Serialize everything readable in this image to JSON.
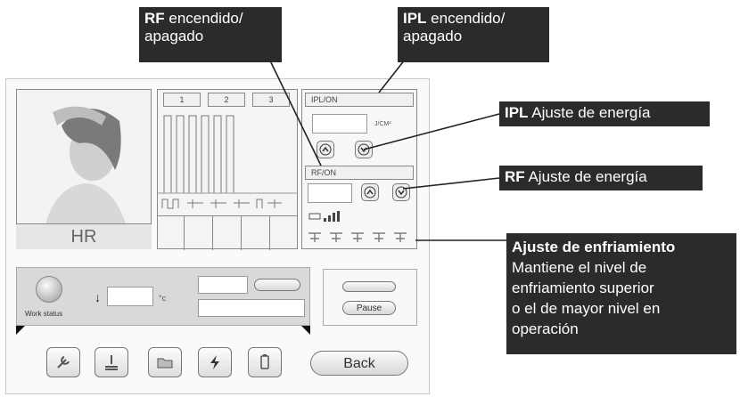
{
  "device": {
    "mode_label": "HR",
    "pulse_tabs": [
      "1",
      "2",
      "3"
    ],
    "ipl_header": "IPL/ON",
    "ipl_unit": "J/CM²",
    "rf_header": "RF/ON",
    "work_status_label": "Work status",
    "temp_unit": "°c",
    "pause_label": "Pause",
    "back_label": "Back"
  },
  "callouts": {
    "rf_onoff_bold": "RF",
    "rf_onoff_text1": " encendido/",
    "rf_onoff_text2": "apagado",
    "ipl_onoff_bold": "IPL",
    "ipl_onoff_text1": " encendido/",
    "ipl_onoff_text2": "apagado",
    "ipl_energy_bold": "IPL",
    "ipl_energy_text": " Ajuste de energía",
    "rf_energy_bold": "RF",
    "rf_energy_text": " Ajuste de energía",
    "cooling_title": "Ajuste de enfriamiento",
    "cooling_line1": "Mantiene el nivel de",
    "cooling_line2": "enfriamiento superior",
    "cooling_line3": "o el de mayor nivel en",
    "cooling_line4": "operación"
  },
  "icons": [
    "wrench-icon",
    "handpiece-icon",
    "folder-icon",
    "lightning-icon",
    "battery-icon",
    "up-arrow-icon",
    "down-arrow-icon",
    "temp-down-icon"
  ]
}
